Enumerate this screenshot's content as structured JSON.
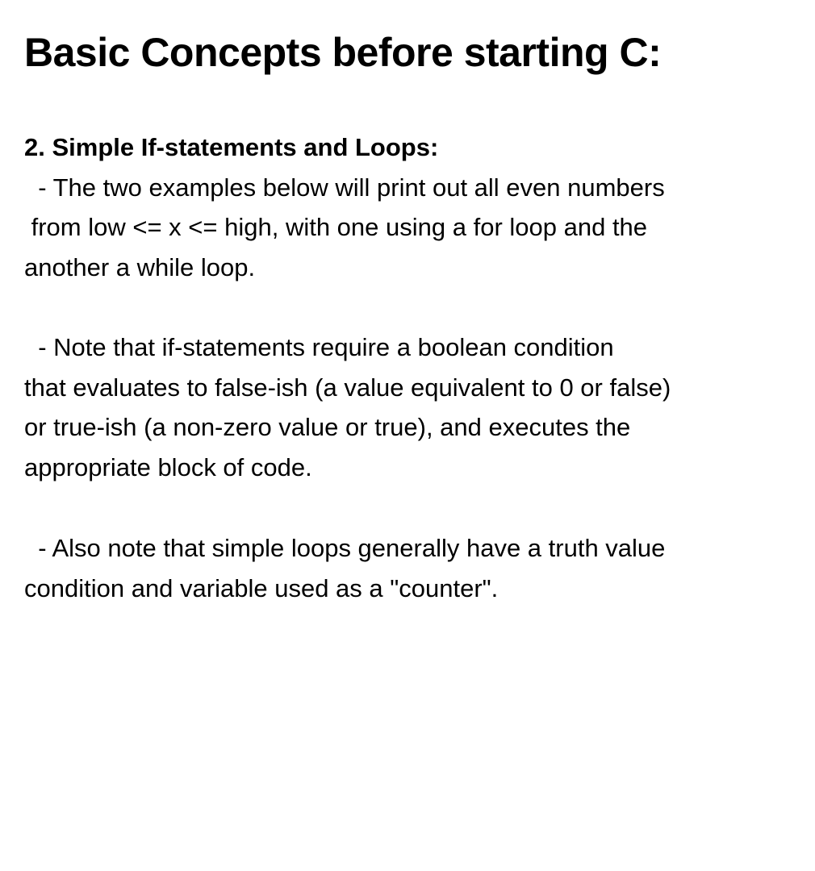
{
  "title": "Basic Concepts before starting C:",
  "section_heading": "2. Simple If-statements and Loops:",
  "paragraphs": [
    {
      "lines": [
        "  - The two examples below will print out all even numbers",
        " from low <= x <= high, with one using a for loop and the",
        "another a while loop."
      ]
    },
    {
      "lines": [
        "  - Note that if-statements require a boolean condition",
        "that evaluates to false-ish (a value equivalent to 0 or false)",
        "or true-ish (a non-zero value or true), and executes the",
        "appropriate block of code."
      ]
    },
    {
      "lines": [
        "  - Also note that simple loops generally have a truth value",
        "condition and variable used as a \"counter\"."
      ]
    }
  ]
}
